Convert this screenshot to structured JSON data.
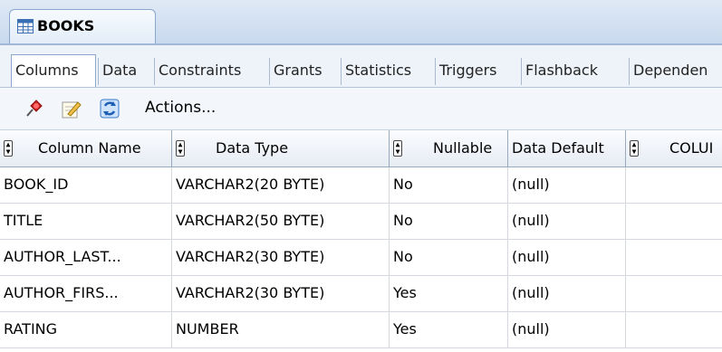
{
  "editor": {
    "tab_title": "BOOKS"
  },
  "subtabs": [
    "Columns",
    "Data",
    "Constraints",
    "Grants",
    "Statistics",
    "Triggers",
    "Flashback",
    "Dependen"
  ],
  "toolbar": {
    "icons": [
      "pin-icon",
      "edit-icon",
      "refresh-icon"
    ],
    "actions_label": "Actions..."
  },
  "columns_table": {
    "headers": [
      "Column Name",
      "Data Type",
      "Nullable",
      "Data Default",
      "COLUI"
    ],
    "rows": [
      [
        "BOOK_ID",
        "VARCHAR2(20 BYTE)",
        "No",
        "(null)",
        ""
      ],
      [
        "TITLE",
        "VARCHAR2(50 BYTE)",
        "No",
        "(null)",
        ""
      ],
      [
        "AUTHOR_LAST...",
        "VARCHAR2(30 BYTE)",
        "No",
        "(null)",
        ""
      ],
      [
        "AUTHOR_FIRS...",
        "VARCHAR2(30 BYTE)",
        "Yes",
        "(null)",
        ""
      ],
      [
        "RATING",
        "NUMBER",
        "Yes",
        "(null)",
        ""
      ]
    ]
  }
}
